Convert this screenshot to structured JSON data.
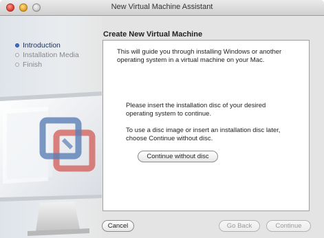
{
  "window": {
    "title": "New Virtual Machine Assistant"
  },
  "sidebar": {
    "steps": [
      {
        "label": "Introduction",
        "active": true
      },
      {
        "label": "Installation Media",
        "active": false
      },
      {
        "label": "Finish",
        "active": false
      }
    ],
    "art_icon": "vmware-fusion-monitor-logo"
  },
  "main": {
    "heading": "Create New Virtual Machine",
    "intro": "This will guide you through installing Windows or another operating system in a virtual machine on your Mac.",
    "insert_disc": "Please insert the installation disc of your desired operating system to continue.",
    "disc_image_hint": "To use a disc image or insert an installation disc later, choose Continue without disc.",
    "continue_without_disc_label": "Continue without disc"
  },
  "footer": {
    "cancel_label": "Cancel",
    "back_label": "Go Back",
    "continue_label": "Continue"
  },
  "colors": {
    "step_active_dot": "#3b6fcf",
    "logo_blue": "#5b7fb6",
    "logo_red": "#d05b55"
  }
}
